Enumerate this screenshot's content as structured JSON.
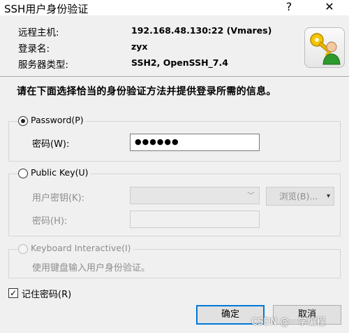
{
  "window": {
    "title": "SSH用户身份验证",
    "help_label": "?",
    "close_label": "✕"
  },
  "info": {
    "host_label": "远程主机:",
    "host_value": "192.168.48.130:22 (Vmares)",
    "login_label": "登录名:",
    "login_value": "zyx",
    "type_label": "服务器类型:",
    "type_value": "SSH2, OpenSSH_7.4"
  },
  "instruction": "请在下面选择恰当的身份验证方法并提供登录所需的信息。",
  "password_group": {
    "label": "Password(P)",
    "selected": true,
    "field_label": "密码(W):",
    "masked_value": "●●●●●●"
  },
  "publickey_group": {
    "label": "Public Key(U)",
    "selected": false,
    "user_key_label": "用户密钥(K):",
    "browse_label": "浏览(B)...",
    "passphrase_label": "密码(H):"
  },
  "keyboard_group": {
    "label": "Keyboard Interactive(I)",
    "selected": false,
    "description": "使用键盘输入用户身份验证。"
  },
  "remember": {
    "label": "记住密码(R)",
    "checked": true,
    "check_glyph": "✓"
  },
  "buttons": {
    "ok": "确定",
    "cancel": "取消"
  },
  "watermark": "CSDN @一学编程",
  "colors": {
    "accent": "#0078d7",
    "disabled_text": "#8d8d8d"
  }
}
